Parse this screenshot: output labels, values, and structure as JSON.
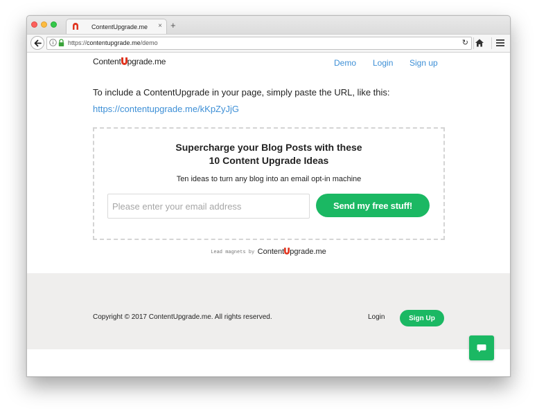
{
  "browser": {
    "tab_title": "ContentUpgrade.me",
    "tab_close": "×",
    "new_tab": "+",
    "url_prefix": "https://",
    "url_domain": "contentupgrade.me",
    "url_path": "/demo",
    "reload": "↻"
  },
  "header": {
    "logo_before": "Content",
    "logo_after": "pgrade.me",
    "nav": [
      {
        "label": "Demo"
      },
      {
        "label": "Login"
      },
      {
        "label": "Sign up"
      }
    ]
  },
  "main": {
    "intro": "To include a ContentUpgrade in your page, simply paste the URL, like this:",
    "demo_link": "https://contentupgrade.me/kKpZyJjG"
  },
  "optin": {
    "title_line1": "Supercharge your Blog Posts with these",
    "title_line2": "10 Content Upgrade Ideas",
    "subtitle": "Ten ideas to turn any blog into an email opt-in machine",
    "email_placeholder": "Please enter your email address",
    "submit_label": "Send my free stuff!"
  },
  "leadmag": {
    "text": "Lead magnets by",
    "logo_before": "Content",
    "logo_after": "pgrade.me"
  },
  "footer": {
    "copyright": "Copyright © 2017 ContentUpgrade.me. All rights reserved.",
    "login": "Login",
    "signup": "Sign Up"
  },
  "colors": {
    "accent_green": "#1bb863",
    "link_blue": "#3d8fd6",
    "logo_red": "#e0341f",
    "footer_bg": "#efeeed"
  }
}
